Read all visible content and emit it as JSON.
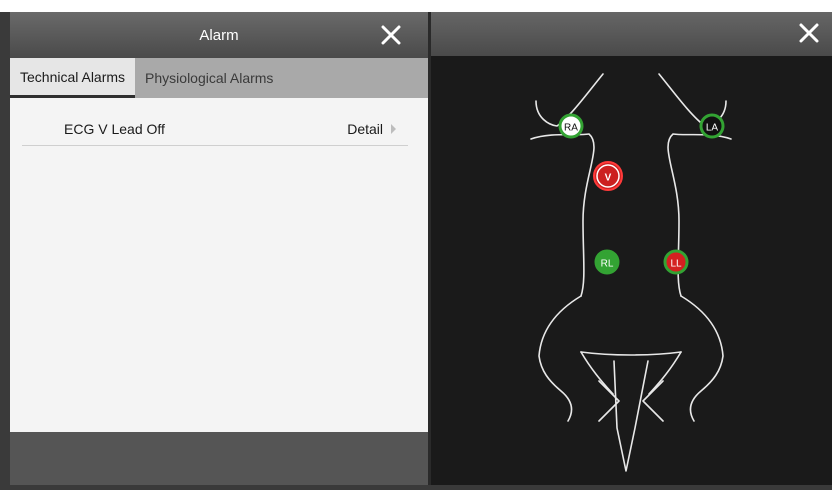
{
  "alarm_dialog": {
    "title": "Alarm",
    "close_icon": "close-icon",
    "tabs": [
      {
        "label": "Technical Alarms",
        "active": true
      },
      {
        "label": "Physiological Alarms",
        "active": false
      }
    ],
    "alarms": [
      {
        "message": "ECG V Lead Off",
        "action": "Detail"
      }
    ]
  },
  "lead_diagram": {
    "close_icon": "close-icon",
    "electrodes": [
      {
        "label": "RA",
        "fill": "#ffffff",
        "ring": "#33a333",
        "text_color": "#111111"
      },
      {
        "label": "LA",
        "fill": "#111111",
        "ring": "#33a333",
        "text_color": "#ffffff"
      },
      {
        "label": "V",
        "fill": "#cc2020",
        "ring": "#cc2020",
        "text_color": "#ffffff"
      },
      {
        "label": "RL",
        "fill": "#33a333",
        "ring": "#33a333",
        "text_color": "#ffffff"
      },
      {
        "label": "LL",
        "fill": "#d42020",
        "ring": "#33a333",
        "text_color": "#ffffff"
      }
    ]
  }
}
